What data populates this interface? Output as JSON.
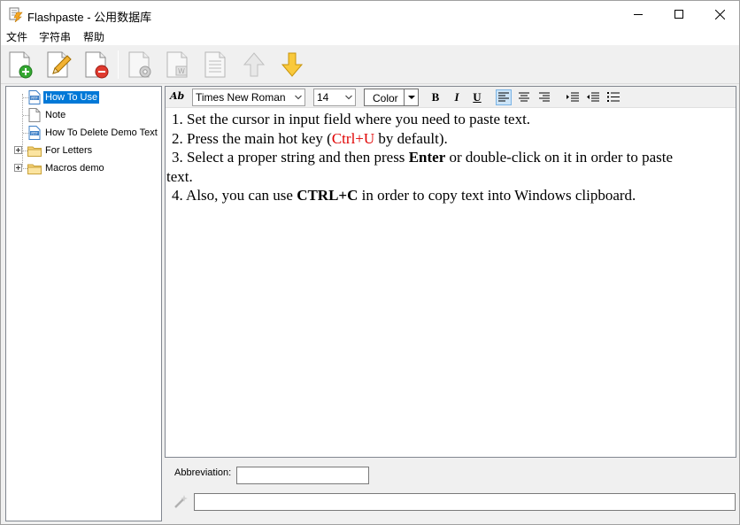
{
  "window": {
    "title": "Flashpaste - 公用数据库"
  },
  "menu": {
    "items": [
      "文件",
      "字符串",
      "帮助"
    ]
  },
  "toolbar": {
    "buttons": [
      "new-item-icon",
      "edit-item-icon",
      "delete-item-icon",
      "settings-icon",
      "word-document-icon",
      "table-document-icon",
      "move-up-icon",
      "move-down-icon"
    ]
  },
  "tree": {
    "items": [
      {
        "label": "How To Use",
        "type": "rtf",
        "selected": true
      },
      {
        "label": "Note",
        "type": "text",
        "selected": false
      },
      {
        "label": "How To Delete Demo Text",
        "type": "rtf",
        "selected": false
      },
      {
        "label": "For Letters",
        "type": "folder",
        "selected": false
      },
      {
        "label": "Macros demo",
        "type": "folder",
        "selected": false
      }
    ]
  },
  "format_bar": {
    "style_label": "Ab",
    "font": "Times New Roman",
    "size": "14",
    "color_label": "Color",
    "bold": "B",
    "italic": "I",
    "underline": "U"
  },
  "document": {
    "line1": "1. Set the cursor in input field where you need to paste text.",
    "line2_a": "2. Press the main hot key (",
    "line2_red": "Ctrl+U",
    "line2_b": " by default).",
    "line3_a": "3. Select a proper string and then press ",
    "line3_bold": "Enter",
    "line3_b": " or double-click on it in order to paste",
    "line3_c": "text.",
    "line4_a": "4. Also, you can use ",
    "line4_bold": "CTRL+C",
    "line4_b": " in order to copy text into Windows clipboard."
  },
  "bottom": {
    "abbreviation_label": "Abbreviation:",
    "abbreviation_value": "",
    "macro_value": ""
  },
  "colors": {
    "selection": "#0078d7",
    "highlight_red": "#e00000"
  }
}
